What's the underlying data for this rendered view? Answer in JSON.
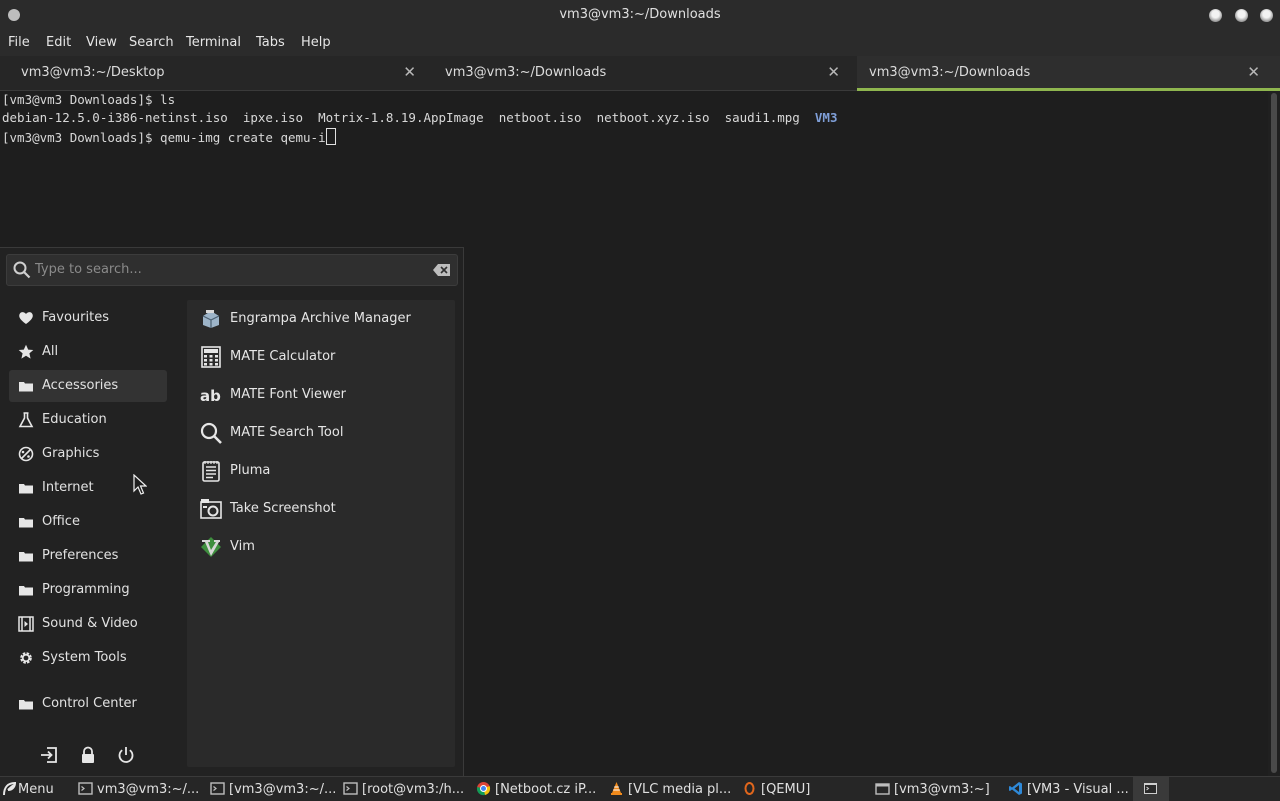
{
  "window": {
    "title": "vm3@vm3:~/Downloads"
  },
  "menubar": [
    "File",
    "Edit",
    "View",
    "Search",
    "Terminal",
    "Tabs",
    "Help"
  ],
  "tabs": [
    {
      "label": "vm3@vm3:~/Desktop",
      "active": false
    },
    {
      "label": "vm3@vm3:~/Downloads",
      "active": false
    },
    {
      "label": "vm3@vm3:~/Downloads",
      "active": true
    }
  ],
  "terminal": {
    "line1": "[vm3@vm3 Downloads]$ ls",
    "files": [
      "debian-12.5.0-i386-netinst.iso",
      "ipxe.iso",
      "Motrix-1.8.19.AppImage",
      "netboot.iso",
      "netboot.xyz.iso",
      "saudi1.mpg"
    ],
    "dir": "VM3",
    "line3": "[vm3@vm3 Downloads]$ qemu-img create qemu-i"
  },
  "appmenu": {
    "search_placeholder": "Type to search...",
    "categories": [
      {
        "label": "Favourites",
        "icon": "heart-icon"
      },
      {
        "label": "All",
        "icon": "star-icon"
      },
      {
        "label": "Accessories",
        "icon": "folder-icon",
        "selected": true
      },
      {
        "label": "Education",
        "icon": "flask-icon"
      },
      {
        "label": "Graphics",
        "icon": "palette-icon"
      },
      {
        "label": "Internet",
        "icon": "folder-icon"
      },
      {
        "label": "Office",
        "icon": "folder-icon"
      },
      {
        "label": "Preferences",
        "icon": "folder-icon"
      },
      {
        "label": "Programming",
        "icon": "folder-icon"
      },
      {
        "label": "Sound & Video",
        "icon": "media-icon"
      },
      {
        "label": "System Tools",
        "icon": "gear-icon"
      },
      {
        "label": "Control Center",
        "icon": "folder-icon"
      }
    ],
    "apps": [
      {
        "label": "Engrampa Archive Manager",
        "icon": "archive-icon"
      },
      {
        "label": "MATE Calculator",
        "icon": "calculator-icon"
      },
      {
        "label": "MATE Font Viewer",
        "icon": "font-icon"
      },
      {
        "label": "MATE Search Tool",
        "icon": "search-icon"
      },
      {
        "label": "Pluma",
        "icon": "text-editor-icon"
      },
      {
        "label": "Take Screenshot",
        "icon": "camera-icon"
      },
      {
        "label": "Vim",
        "icon": "vim-icon"
      }
    ]
  },
  "taskbar": {
    "menu_label": "Menu",
    "tasks": [
      "vm3@vm3:~/...",
      "[vm3@vm3:~/...",
      "[root@vm3:/h...",
      "[Netboot.cz iP...",
      "[VLC media pl...",
      "[QEMU]",
      "[vm3@vm3:~]",
      "[VM3 - Visual ..."
    ]
  },
  "colors": {
    "accent": "#8fb64f",
    "dir": "#7f9fd8"
  }
}
